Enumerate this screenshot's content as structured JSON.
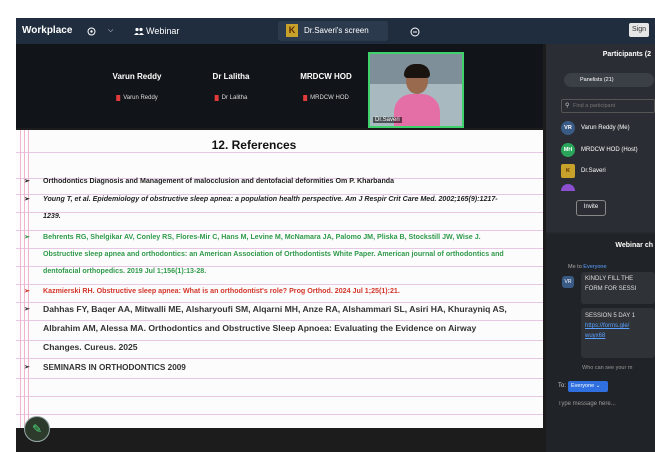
{
  "topbar": {
    "app_title": "Workplace",
    "camera_icon": "camera-icon",
    "dropdown_icon": "chevron-down-icon",
    "webinar_icon": "people-icon",
    "webinar_label": "Webinar",
    "screen_tab_badge": "K",
    "screen_tab_label": "Dr.Saveri's screen",
    "share_icon": "record-icon",
    "sign_label": "Sign"
  },
  "video_strip": {
    "tiles": [
      {
        "name": "Varun Reddy",
        "tag": "Varun Reddy"
      },
      {
        "name": "Dr Lalitha",
        "tag": "Dr Lalitha"
      },
      {
        "name": "MRDCW HOD",
        "tag": "MRDCW HOD"
      }
    ],
    "active_speaker_tag": "Dr.Saveri"
  },
  "slide": {
    "title": "12. References",
    "bullet": "➢",
    "references": [
      {
        "text": "Orthodontics Diagnosis and Management of malocclusion and dentofacial deformities Om P. Kharbanda",
        "color": "#222222"
      },
      {
        "text": "Young T, et al. Epidemiology of obstructive sleep apnea: a population health perspective. Am J Respir Crit Care Med. 2002;165(9):1217-1239.",
        "color": "#222222"
      },
      {
        "text": "Behrents RG, Shelgikar AV, Conley RS, Flores-Mir C, Hans M, Levine M, McNamara JA, Palomo JM, Pliska B, Stockstill JW, Wise J. Obstructive sleep apnea and orthodontics: an American Association of Orthodontists White Paper. American journal of orthodontics and dentofacial orthopedics. 2019 Jul 1;156(1):13-28.",
        "color": "#2f9a4a"
      },
      {
        "text": "Kazmierski RH. Obstructive sleep apnea: What is an orthodontist's role? Prog Orthod. 2024 Jul 1;25(1):21.",
        "color": "#d2352a"
      },
      {
        "text": "Dahhas FY, Baqer AA, Mitwalli ME, Alsharyoufi SM, Alqarni MH, Anze RA, Alshammari SL, Asiri HA, Khurayniq AS, Albrahim AM, Alessa MA. Orthodontics and Obstructive Sleep Apnoea: Evaluating the Evidence on Airway Changes. Cureus. 2025",
        "color": "#333333"
      },
      {
        "text": "SEMINARS IN ORTHODONTICS  2009",
        "color": "#333333"
      }
    ],
    "annotate_icon": "pencil-icon"
  },
  "participants": {
    "header": "Participants (2",
    "tab_label": "Panelists (21)",
    "search_icon": "search-icon",
    "search_placeholder": "Find a participant",
    "list": [
      {
        "initials": "VR",
        "name": "Varun Reddy (Me)"
      },
      {
        "initials": "MH",
        "name": "MRDCW HOD (Host)"
      },
      {
        "initials": "K",
        "name": "Dr.Saveri"
      }
    ],
    "invite_label": "Invite"
  },
  "chat": {
    "header": "Webinar ch",
    "meta_prefix": "Me to ",
    "meta_to": "Everyone",
    "avatar": "VR",
    "message_1": "KINDLY FILL THE FORM FOR SESSI",
    "message_2_text": "SESSION 5 DAY 1",
    "message_2_link": "https://forms.gle/ wuyx68",
    "hint": "Who can see your m",
    "to_label": "To:",
    "to_value": "Everyone ⌄",
    "input_placeholder": "Type message here..."
  }
}
